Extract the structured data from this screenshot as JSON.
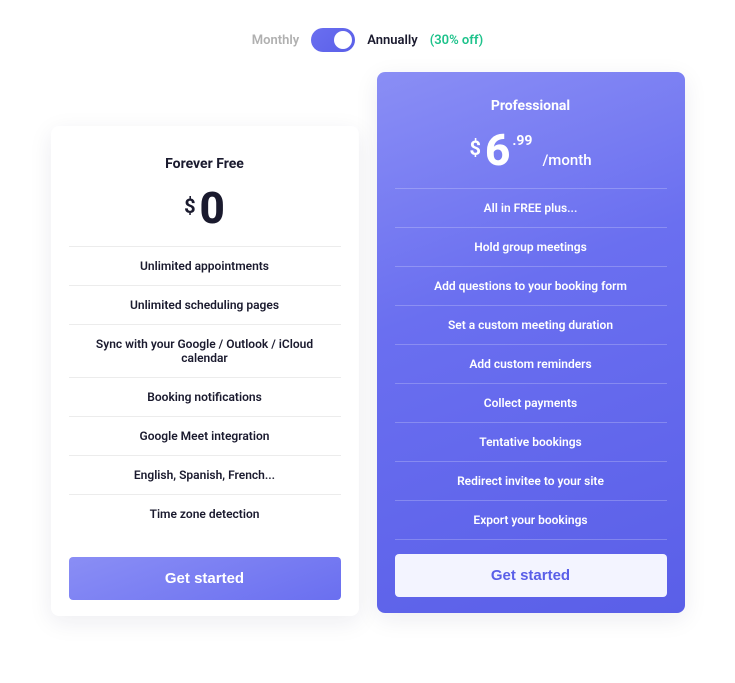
{
  "billing": {
    "monthly_label": "Monthly",
    "annually_label": "Annually",
    "discount_label": "(30% off)",
    "active": "annually"
  },
  "plans": {
    "free": {
      "name": "Forever Free",
      "currency": "$",
      "price_whole": "0",
      "features": [
        "Unlimited appointments",
        "Unlimited scheduling pages",
        "Sync with your Google / Outlook / iCloud calendar",
        "Booking notifications",
        "Google Meet integration",
        "English, Spanish, French...",
        "Time zone detection"
      ],
      "cta_label": "Get started"
    },
    "pro": {
      "name": "Professional",
      "currency": "$",
      "price_whole": "6",
      "price_cents": ".99",
      "period": "/month",
      "features": [
        "All in FREE plus...",
        "Hold group meetings",
        "Add questions to your booking form",
        "Set a custom meeting duration",
        "Add custom reminders",
        "Collect payments",
        "Tentative bookings",
        "Redirect invitee to your site",
        "Export your bookings"
      ],
      "cta_label": "Get started"
    }
  }
}
